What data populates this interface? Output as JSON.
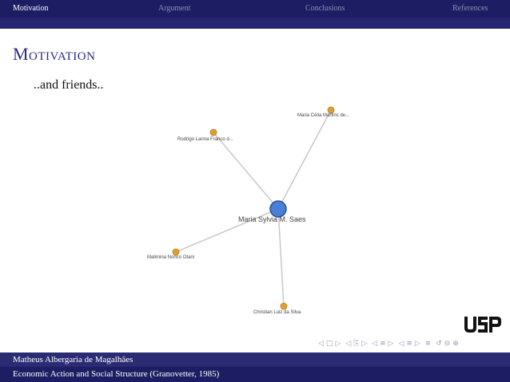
{
  "nav": {
    "sections": [
      "Motivation",
      "Argument",
      "Conclusions",
      "References"
    ],
    "active": "Motivation"
  },
  "frame": {
    "title": "Motivation",
    "subtitle": "..and friends.."
  },
  "graph": {
    "center": {
      "label": "Maria Sylvia M. Saes"
    },
    "friends": [
      {
        "label": "Maria Célia Martins de..."
      },
      {
        "label": "Rodrigo Lanna Franco d..."
      },
      {
        "label": "Malimina Norico Otani"
      },
      {
        "label": "Christian Luiz da Silva"
      }
    ]
  },
  "nav_symbols": [
    "◁",
    "□",
    "▷",
    "◁",
    "⎘",
    "▷",
    "◁",
    "≡",
    "▷",
    "◁",
    "≡",
    "▷",
    "≡",
    "↺",
    "⊖",
    "⊕"
  ],
  "logo": {
    "text": "USP"
  },
  "footer": {
    "author": "Matheus Albergaria de Magalhães",
    "talk": "Economic Action and Social Structure (Granovetter, 1985)"
  },
  "colors": {
    "nav_bg": "#1d1d63",
    "title": "#2a2a86",
    "center_node": "#4a7fd6",
    "friend_node": "#e0a030"
  }
}
